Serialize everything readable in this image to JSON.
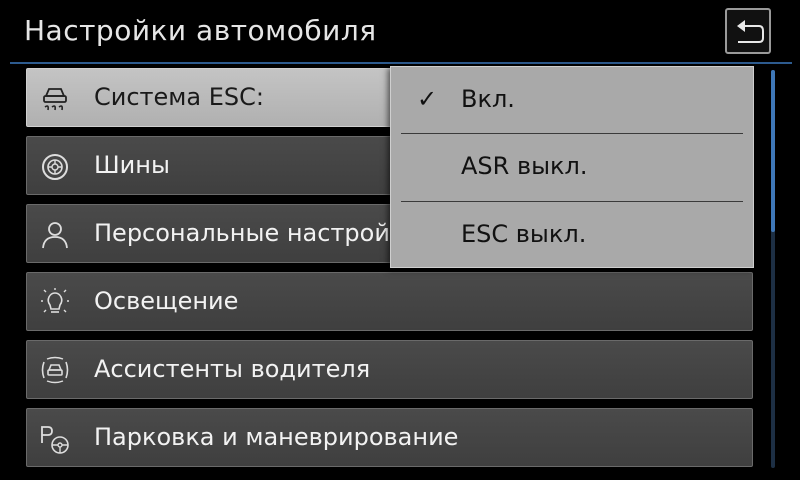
{
  "header": {
    "title": "Настройки автомобиля"
  },
  "menu": {
    "items": [
      {
        "label": "Система ESC:",
        "icon": "esc-skid-car-icon",
        "active": true
      },
      {
        "label": "Шины",
        "icon": "tire-icon",
        "active": false
      },
      {
        "label": "Персональные настройки",
        "icon": "person-icon",
        "active": false
      },
      {
        "label": "Освещение",
        "icon": "light-bulb-icon",
        "active": false
      },
      {
        "label": "Ассистенты водителя",
        "icon": "driver-assist-car-icon",
        "active": false
      },
      {
        "label": "Парковка и маневрирование",
        "icon": "parking-steering-icon",
        "active": false
      }
    ]
  },
  "dropdown": {
    "selected": "Вкл.",
    "options": [
      {
        "label": "Вкл.",
        "checked": true
      },
      {
        "label": "ASR выкл.",
        "checked": false
      },
      {
        "label": "ESC выкл.",
        "checked": false
      }
    ],
    "check_glyph": "✓"
  },
  "colors": {
    "accent_line": "#2d5b8f",
    "scroll_thumb": "#3f78b8",
    "menu_bg": "#464646",
    "active_bg": "#bdbdbd",
    "dropdown_bg": "#a9a9a9"
  }
}
